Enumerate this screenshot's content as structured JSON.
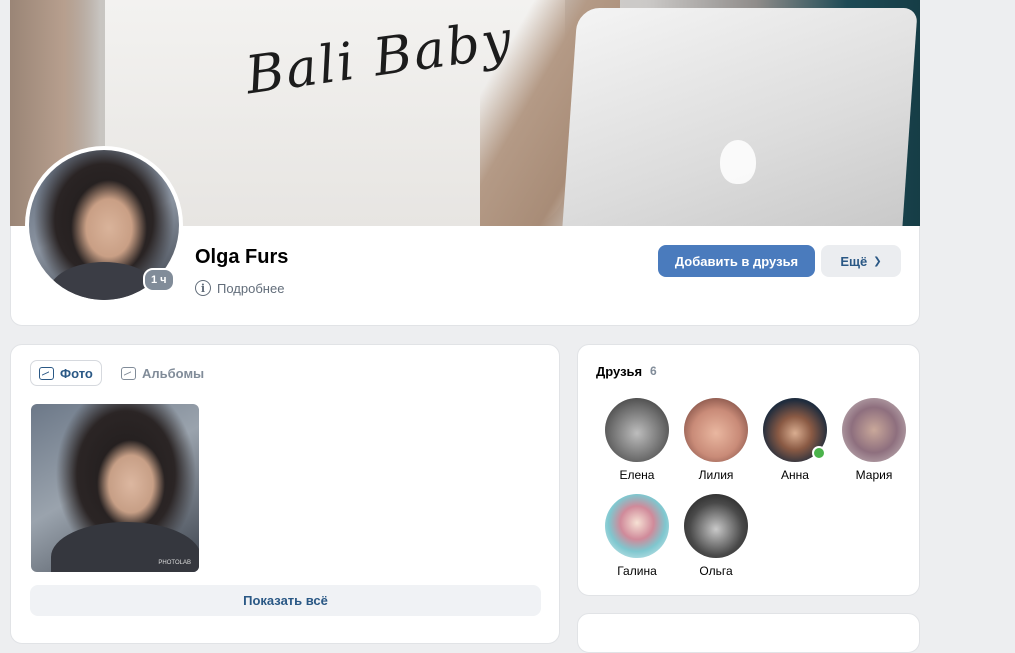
{
  "cover": {
    "shirt_text": "Bali Baby"
  },
  "profile": {
    "name": "Olga Furs",
    "online_badge": "1 ч",
    "more_info": "Подробнее",
    "add_friend": "Добавить в друзья",
    "more": "Ещё"
  },
  "photos": {
    "tab_photo": "Фото",
    "tab_albums": "Альбомы",
    "show_all": "Показать всё",
    "watermark": "PHOTOLAB"
  },
  "friends": {
    "title": "Друзья",
    "count": "6",
    "items": [
      {
        "name": "Елена",
        "online": false,
        "color": "#6e6e6e"
      },
      {
        "name": "Лилия",
        "online": false,
        "color": "#c98b78"
      },
      {
        "name": "Анна",
        "online": true,
        "color": "#2b3f55"
      },
      {
        "name": "Мария",
        "online": false,
        "color": "#8e6f7e"
      },
      {
        "name": "Галина",
        "online": false,
        "color": "#7fc7cf"
      },
      {
        "name": "Ольга",
        "online": false,
        "color": "#4a4a4a"
      }
    ]
  },
  "colors": {
    "accent": "#4a7bbd",
    "link": "#2a5885",
    "background": "#edeef0",
    "online": "#4bb34b"
  }
}
